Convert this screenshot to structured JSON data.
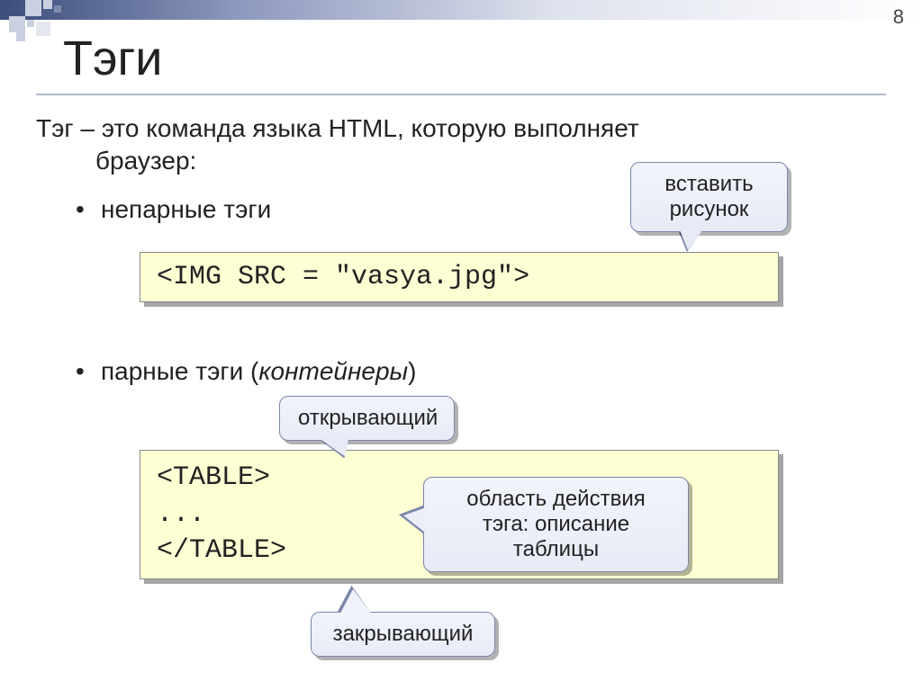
{
  "page_number": "8",
  "title": "Тэги",
  "definition_line1": "Тэг – это команда языка HTML, которую выполняет",
  "definition_line2": "браузер:",
  "bullet1": "непарные тэги",
  "bullet2_a": "парные тэги (",
  "bullet2_b": "контейнеры",
  "bullet2_c": ")",
  "code1": "<IMG SRC = \"vasya.jpg\">",
  "code2_line1": "<TABLE>",
  "code2_line2": "...",
  "code2_line3": "</TABLE>",
  "callout_insert_img_l1": "вставить",
  "callout_insert_img_l2": "рисунок",
  "callout_opening": "открывающий",
  "callout_scope_l1": "область действия",
  "callout_scope_l2": "тэга: описание",
  "callout_scope_l3": "таблицы",
  "callout_closing": "закрывающий"
}
